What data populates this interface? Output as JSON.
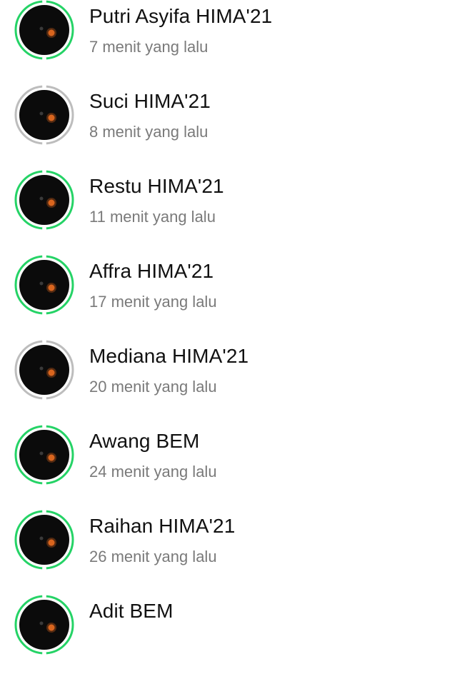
{
  "colors": {
    "ring_unseen": "#25D366",
    "ring_seen": "#BDBDBD",
    "avatar_bg": "#0b0b0b",
    "avatar_light": "#d9651e",
    "name_text": "#111111",
    "time_text": "#7a7a7a"
  },
  "statuses": [
    {
      "name": "Putri Asyifa HIMA'21",
      "time": "7 menit yang lalu",
      "seen": false
    },
    {
      "name": "Suci HIMA'21",
      "time": "8 menit yang lalu",
      "seen": true
    },
    {
      "name": "Restu HIMA'21",
      "time": "11 menit yang lalu",
      "seen": false
    },
    {
      "name": "Affra HIMA'21",
      "time": "17 menit yang lalu",
      "seen": false
    },
    {
      "name": "Mediana HIMA'21",
      "time": "20 menit yang lalu",
      "seen": true
    },
    {
      "name": "Awang BEM",
      "time": "24 menit yang lalu",
      "seen": false
    },
    {
      "name": "Raihan HIMA'21",
      "time": "26 menit yang lalu",
      "seen": false
    },
    {
      "name": "Adit BEM",
      "time": "",
      "seen": false
    }
  ]
}
